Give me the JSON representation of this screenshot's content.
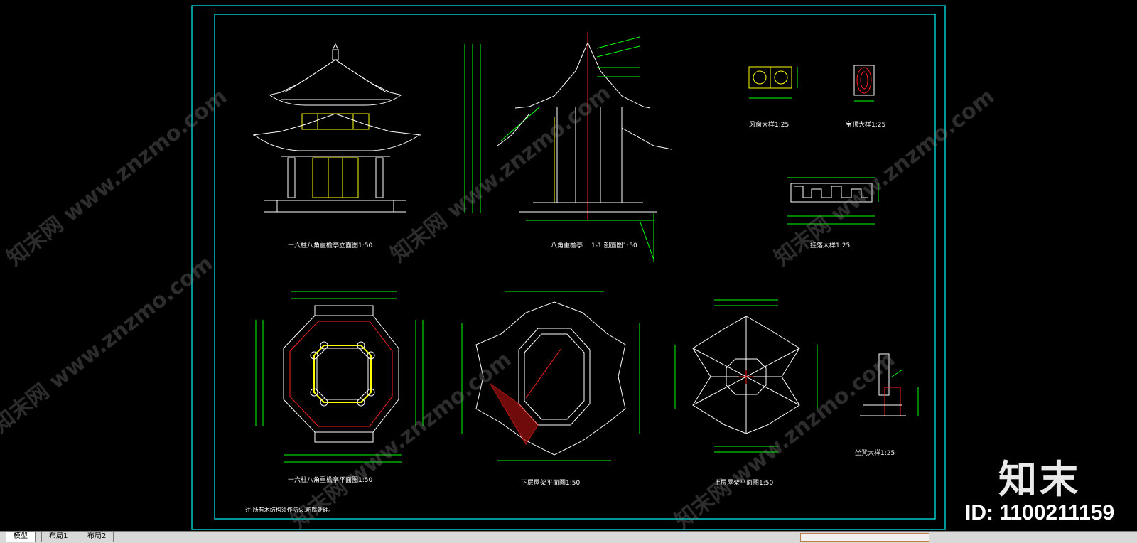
{
  "drawing": {
    "labels": {
      "elevation": "十六柱八角重檐亭立面图1:50",
      "section_left": "八角重檐亭",
      "section_right": "1-1   剖面图1:50",
      "detail1": "风窗大样1:25",
      "detail2": "宝顶大样1:25",
      "railing": "挂落大样1:25",
      "plan1": "十六柱八角重檐亭平面图1:50",
      "plan2": "下层屋架平面图1:50",
      "plan3": "上层屋架平面图1:50",
      "plan4": "坐凳大样1:25",
      "note": "注:所有木结构须作防火,防腐处理。"
    },
    "watermark": {
      "text": "知末网 www.znzmo.com",
      "logo": "知末",
      "id": "ID: 1100211159"
    }
  },
  "tabs": [
    {
      "label": "模型",
      "active": true
    },
    {
      "label": "布局1",
      "active": false
    },
    {
      "label": "布局2",
      "active": false
    }
  ],
  "colors": {
    "background": "#000000",
    "border": "#00c8c8",
    "lines": "#ffffff",
    "dimension": "#00ff00",
    "highlight": "#ffff00",
    "accent": "#ff2020"
  }
}
